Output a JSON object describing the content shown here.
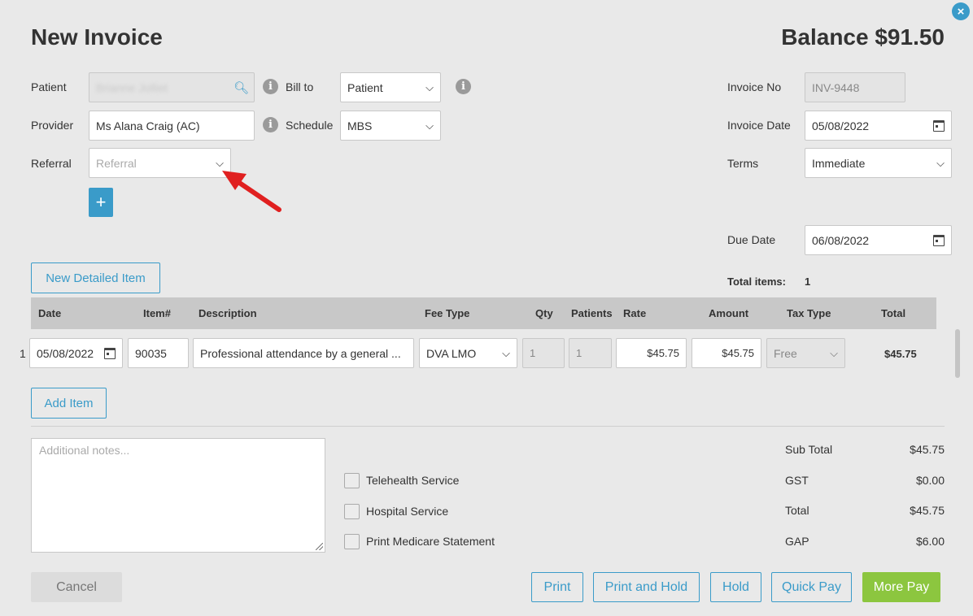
{
  "header": {
    "title": "New Invoice",
    "balance": "Balance $91.50",
    "close_icon": "×"
  },
  "left_form": {
    "patient_label": "Patient",
    "patient_value": "Brianne Jolliet",
    "provider_label": "Provider",
    "provider_value": "Ms Alana Craig (AC)",
    "referral_label": "Referral",
    "referral_placeholder": "Referral",
    "bill_to_label": "Bill to",
    "bill_to_value": "Patient",
    "schedule_label": "Schedule",
    "schedule_value": "MBS",
    "add_label": "+"
  },
  "right_form": {
    "invoice_no_label": "Invoice No",
    "invoice_no_value": "INV-9448",
    "invoice_date_label": "Invoice Date",
    "invoice_date_value": "05/08/2022",
    "terms_label": "Terms",
    "terms_value": "Immediate",
    "due_date_label": "Due Date",
    "due_date_value": "06/08/2022",
    "total_items_label": "Total items:",
    "total_items_value": "1"
  },
  "items": {
    "new_detailed_item_label": "New Detailed Item",
    "add_item_label": "Add Item",
    "columns": [
      "Date",
      "Item#",
      "Description",
      "Fee Type",
      "Qty",
      "Patients",
      "Rate",
      "Amount",
      "Tax Type",
      "Total"
    ],
    "rows": [
      {
        "index": "1",
        "date": "05/08/2022",
        "item_no": "90035",
        "description": "Professional attendance by a general ...",
        "fee_type": "DVA LMO",
        "qty": "1",
        "patients": "1",
        "rate": "$45.75",
        "amount": "$45.75",
        "tax_type": "Free",
        "total": "$45.75"
      }
    ]
  },
  "notes": {
    "placeholder": "Additional notes..."
  },
  "checkboxes": [
    {
      "label": "Telehealth Service"
    },
    {
      "label": "Hospital Service"
    },
    {
      "label": "Print Medicare Statement"
    }
  ],
  "totals": [
    {
      "label": "Sub Total",
      "value": "$45.75"
    },
    {
      "label": "GST",
      "value": "$0.00"
    },
    {
      "label": "Total",
      "value": "$45.75"
    },
    {
      "label": "GAP",
      "value": "$6.00"
    }
  ],
  "footer": {
    "cancel": "Cancel",
    "print": "Print",
    "print_and_hold": "Print and Hold",
    "hold": "Hold",
    "quick_pay": "Quick Pay",
    "more_pay": "More Pay"
  },
  "colors": {
    "accent": "#3a9bc9",
    "primary_action": "#8cc63f",
    "annotation_arrow": "#e02020"
  },
  "icons": {
    "search": "search-icon",
    "info": "info-icon",
    "calendar": "calendar-icon",
    "chevron": "chevron-down-icon",
    "close": "close-icon"
  }
}
